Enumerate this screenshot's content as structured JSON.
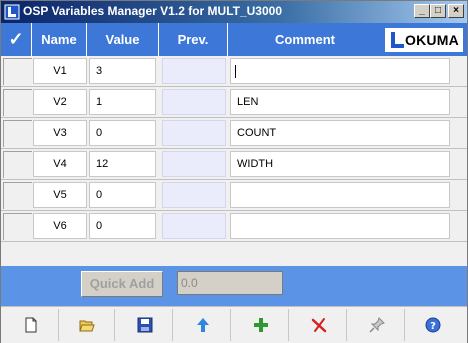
{
  "window": {
    "title": "OSP Variables Manager V1.2 for MULT_U3000",
    "minimize_glyph": "_",
    "maximize_glyph": "□",
    "close_glyph": "×"
  },
  "header": {
    "check_glyph": "✓",
    "columns": {
      "name": "Name",
      "value": "Value",
      "prev": "Prev.",
      "comment": "Comment"
    },
    "logo_text": "OKUMA"
  },
  "rows": [
    {
      "name": "V1",
      "value": "3",
      "prev": "",
      "comment": ""
    },
    {
      "name": "V2",
      "value": "1",
      "prev": "",
      "comment": "LEN"
    },
    {
      "name": "V3",
      "value": "0",
      "prev": "",
      "comment": "COUNT"
    },
    {
      "name": "V4",
      "value": "12",
      "prev": "",
      "comment": "WIDTH"
    },
    {
      "name": "V5",
      "value": "0",
      "prev": "",
      "comment": ""
    },
    {
      "name": "V6",
      "value": "0",
      "prev": "",
      "comment": ""
    }
  ],
  "quick_add": {
    "button_label": "Quick Add",
    "input_value": "0.0"
  },
  "toolbar": {
    "buttons": [
      {
        "icon": "new-file-icon"
      },
      {
        "icon": "open-folder-icon"
      },
      {
        "icon": "save-icon"
      },
      {
        "icon": "upload-arrow-icon"
      },
      {
        "icon": "add-plus-icon"
      },
      {
        "icon": "delete-x-icon"
      },
      {
        "icon": "pin-icon"
      },
      {
        "icon": "help-icon"
      }
    ]
  },
  "colors": {
    "header_blue": "#3d78d8",
    "bar_blue": "#5b93e6",
    "prev_cell": "#eaecfb"
  }
}
